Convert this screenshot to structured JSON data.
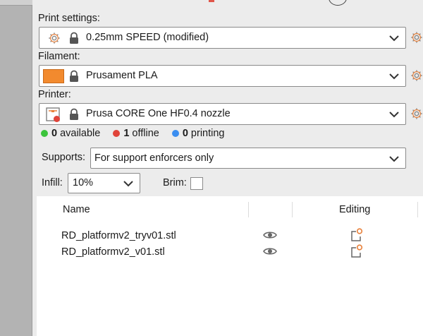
{
  "print_settings": {
    "label": "Print settings:",
    "value": "0.25mm SPEED (modified)",
    "icon": "gear-icon"
  },
  "filament": {
    "label": "Filament:",
    "value": "Prusament PLA",
    "color": "#f28a2e"
  },
  "printer": {
    "label": "Printer:",
    "value": "Prusa CORE One HF0.4 nozzle"
  },
  "status": {
    "available_count": "0",
    "available_label": "available",
    "available_color": "#3cc43c",
    "offline_count": "1",
    "offline_label": "offline",
    "offline_color": "#e0443a",
    "printing_count": "0",
    "printing_label": "printing",
    "printing_color": "#3b8ef0"
  },
  "supports": {
    "label": "Supports:",
    "value": "For support enforcers only"
  },
  "infill": {
    "label": "Infill:",
    "value": "10%"
  },
  "brim": {
    "label": "Brim:",
    "checked": false
  },
  "objects_table": {
    "columns": [
      "Name",
      "",
      "Editing"
    ],
    "rows": [
      {
        "name": "RD_platformv2_tryv01.stl"
      },
      {
        "name": "RD_platformv2_v01.stl"
      }
    ]
  },
  "colors": {
    "accent_orange": "#e8803a",
    "background": "#ececec"
  }
}
